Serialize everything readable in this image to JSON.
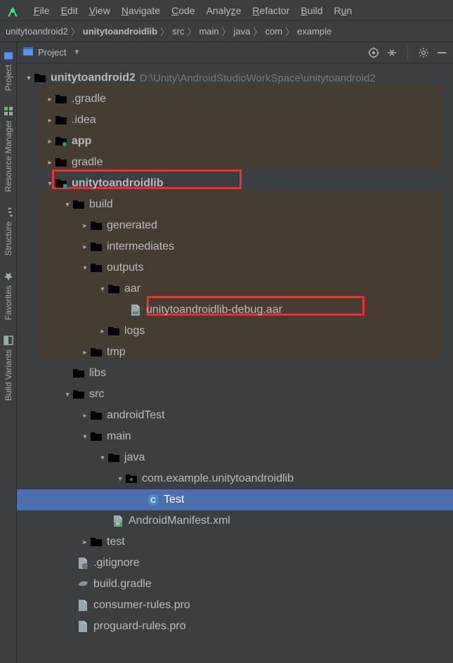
{
  "menu": {
    "items": [
      "File",
      "Edit",
      "View",
      "Navigate",
      "Code",
      "Analyze",
      "Refactor",
      "Build",
      "Run"
    ]
  },
  "breadcrumb": {
    "items": [
      "unitytoandroid2",
      "unitytoandroidlib",
      "src",
      "main",
      "java",
      "com",
      "example"
    ]
  },
  "panel": {
    "title": "Project"
  },
  "vtabs": {
    "items": [
      "Project",
      "Resource Manager",
      "Structure",
      "Favorites",
      "Build Variants"
    ]
  },
  "root": {
    "name": "unitytoandroid2",
    "path": "D:\\Unity\\AndroidStudioWorkSpace\\unitytoandroid2"
  },
  "tree": {
    "gradle_dot": ".gradle",
    "idea": ".idea",
    "app": "app",
    "gradle": "gradle",
    "lib": "unitytoandroidlib",
    "build": "build",
    "generated": "generated",
    "intermediates": "intermediates",
    "outputs": "outputs",
    "aar": "aar",
    "aarfile": "unitytoandroidlib-debug.aar",
    "logs": "logs",
    "tmp": "tmp",
    "libs": "libs",
    "src": "src",
    "androidTest": "androidTest",
    "main_dir": "main",
    "java": "java",
    "pkg": "com.example.unitytoandroidlib",
    "test_class": "Test",
    "manifest": "AndroidManifest.xml",
    "test_dir": "test",
    "gitignore": ".gitignore",
    "buildgradle": "build.gradle",
    "consumer": "consumer-rules.pro",
    "proguard": "proguard-rules.pro"
  }
}
